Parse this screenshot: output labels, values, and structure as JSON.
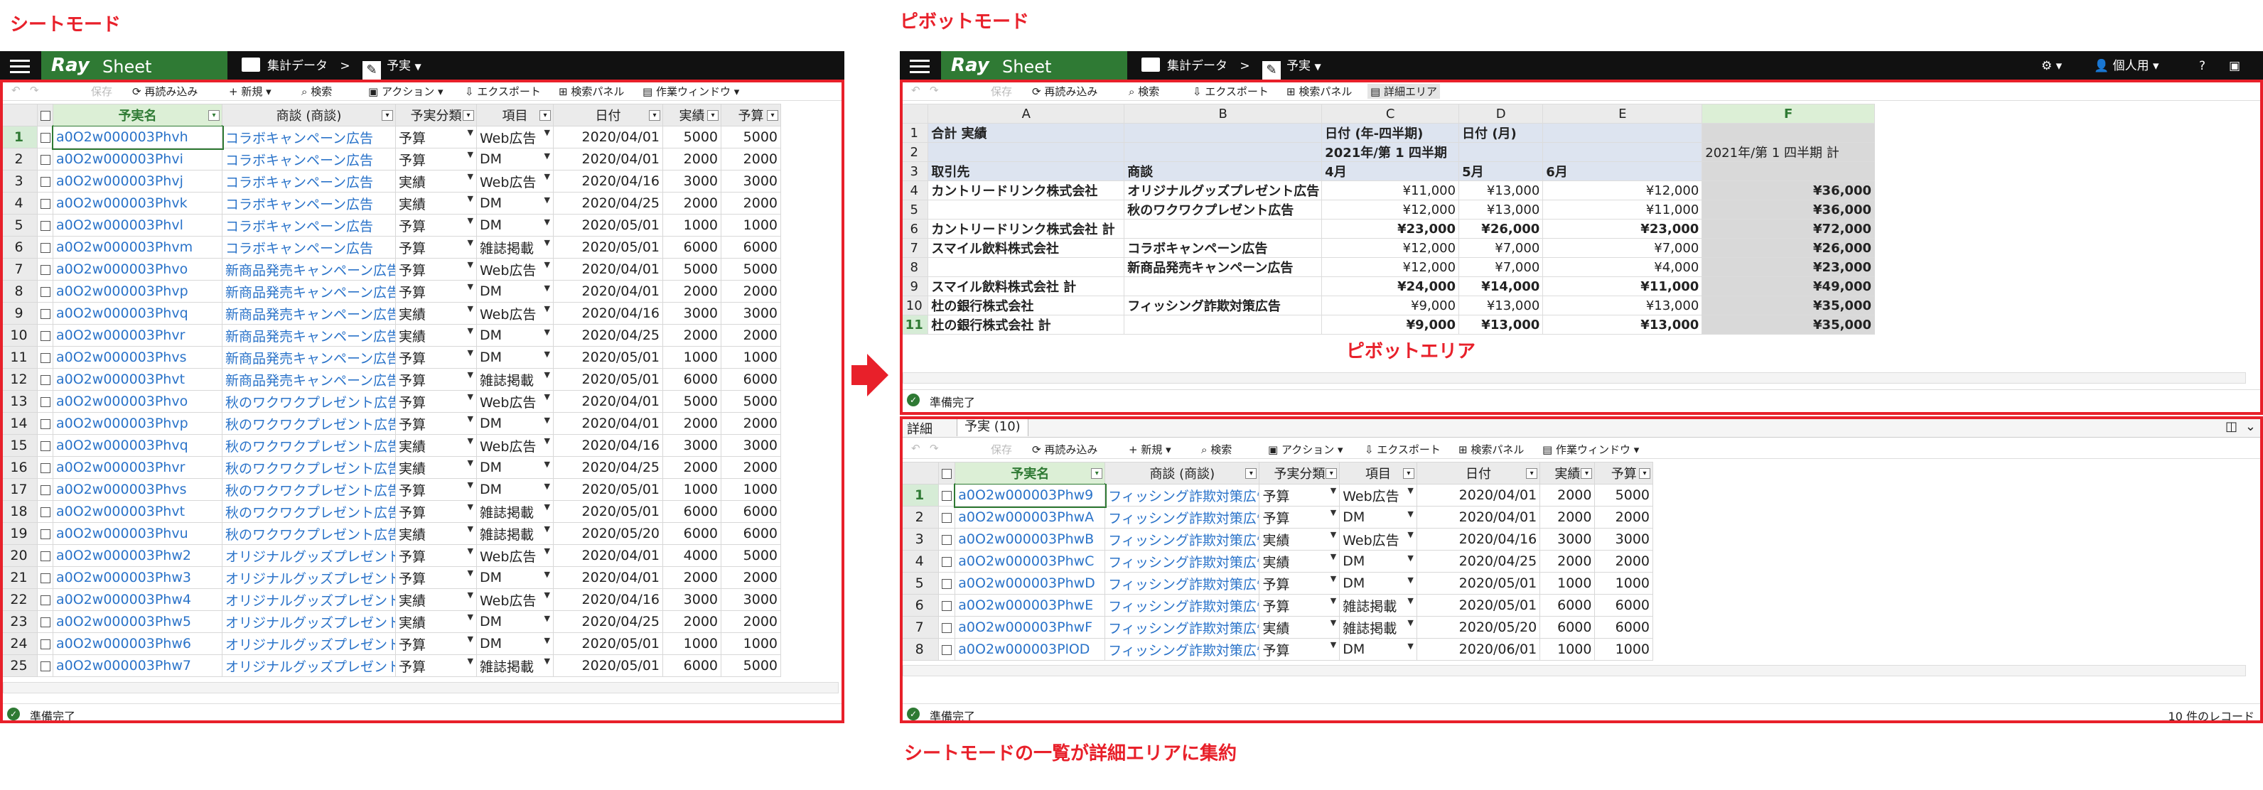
{
  "captions": {
    "sheet_mode": "シートモード",
    "pivot_mode": "ピボットモード",
    "pivot_area": "ピボットエリア",
    "detail_note": "シートモードの一覧が詳細エリアに集約"
  },
  "app": {
    "brand_main": "Ray",
    "brand_sub": "Sheet",
    "crumb_folder": "集計データ",
    "crumb_sep": ">",
    "crumb_sheet": "予実",
    "user_label": "個人用",
    "help": "?"
  },
  "toolbar": {
    "undo": "↶",
    "redo": "↷",
    "save": "保存",
    "reload": "再読み込み",
    "new": "新規",
    "search": "検索",
    "action": "アクション",
    "export": "エクスポート",
    "search_panel": "検索パネル",
    "work_window": "作業ウィンドウ",
    "detail_area": "詳細エリア"
  },
  "sheet": {
    "headers": [
      "予実名",
      "商談 (商談)",
      "予実分類",
      "項目",
      "日付",
      "実績",
      "予算"
    ],
    "rows": [
      [
        "a0O2w000003Phvh",
        "コラボキャンペーン広告",
        "予算",
        "Web広告",
        "2020/04/01",
        "5000",
        "5000"
      ],
      [
        "a0O2w000003Phvi",
        "コラボキャンペーン広告",
        "予算",
        "DM",
        "2020/04/01",
        "2000",
        "2000"
      ],
      [
        "a0O2w000003Phvj",
        "コラボキャンペーン広告",
        "実績",
        "Web広告",
        "2020/04/16",
        "3000",
        "3000"
      ],
      [
        "a0O2w000003Phvk",
        "コラボキャンペーン広告",
        "実績",
        "DM",
        "2020/04/25",
        "2000",
        "2000"
      ],
      [
        "a0O2w000003Phvl",
        "コラボキャンペーン広告",
        "予算",
        "DM",
        "2020/05/01",
        "1000",
        "1000"
      ],
      [
        "a0O2w000003Phvm",
        "コラボキャンペーン広告",
        "予算",
        "雑誌掲載",
        "2020/05/01",
        "6000",
        "6000"
      ],
      [
        "a0O2w000003Phvo",
        "新商品発売キャンペーン広告",
        "予算",
        "Web広告",
        "2020/04/01",
        "5000",
        "5000"
      ],
      [
        "a0O2w000003Phvp",
        "新商品発売キャンペーン広告",
        "予算",
        "DM",
        "2020/04/01",
        "2000",
        "2000"
      ],
      [
        "a0O2w000003Phvq",
        "新商品発売キャンペーン広告",
        "実績",
        "Web広告",
        "2020/04/16",
        "3000",
        "3000"
      ],
      [
        "a0O2w000003Phvr",
        "新商品発売キャンペーン広告",
        "実績",
        "DM",
        "2020/04/25",
        "2000",
        "2000"
      ],
      [
        "a0O2w000003Phvs",
        "新商品発売キャンペーン広告",
        "予算",
        "DM",
        "2020/05/01",
        "1000",
        "1000"
      ],
      [
        "a0O2w000003Phvt",
        "新商品発売キャンペーン広告",
        "予算",
        "雑誌掲載",
        "2020/05/01",
        "6000",
        "6000"
      ],
      [
        "a0O2w000003Phvo",
        "秋のワクワクプレゼント広告",
        "予算",
        "Web広告",
        "2020/04/01",
        "5000",
        "5000"
      ],
      [
        "a0O2w000003Phvp",
        "秋のワクワクプレゼント広告",
        "予算",
        "DM",
        "2020/04/01",
        "2000",
        "2000"
      ],
      [
        "a0O2w000003Phvq",
        "秋のワクワクプレゼント広告",
        "実績",
        "Web広告",
        "2020/04/16",
        "3000",
        "3000"
      ],
      [
        "a0O2w000003Phvr",
        "秋のワクワクプレゼント広告",
        "実績",
        "DM",
        "2020/04/25",
        "2000",
        "2000"
      ],
      [
        "a0O2w000003Phvs",
        "秋のワクワクプレゼント広告",
        "予算",
        "DM",
        "2020/05/01",
        "1000",
        "1000"
      ],
      [
        "a0O2w000003Phvt",
        "秋のワクワクプレゼント広告",
        "予算",
        "雑誌掲載",
        "2020/05/01",
        "6000",
        "6000"
      ],
      [
        "a0O2w000003Phvu",
        "秋のワクワクプレゼント広告",
        "実績",
        "雑誌掲載",
        "2020/05/20",
        "6000",
        "6000"
      ],
      [
        "a0O2w000003Phw2",
        "オリジナルグッズプレゼント広告",
        "予算",
        "Web広告",
        "2020/04/01",
        "4000",
        "5000"
      ],
      [
        "a0O2w000003Phw3",
        "オリジナルグッズプレゼント広告",
        "予算",
        "DM",
        "2020/04/01",
        "2000",
        "2000"
      ],
      [
        "a0O2w000003Phw4",
        "オリジナルグッズプレゼント広告",
        "実績",
        "Web広告",
        "2020/04/16",
        "3000",
        "3000"
      ],
      [
        "a0O2w000003Phw5",
        "オリジナルグッズプレゼント広告",
        "実績",
        "DM",
        "2020/04/25",
        "2000",
        "2000"
      ],
      [
        "a0O2w000003Phw6",
        "オリジナルグッズプレゼント広告",
        "予算",
        "DM",
        "2020/05/01",
        "1000",
        "1000"
      ],
      [
        "a0O2w000003Phw7",
        "オリジナルグッズプレゼント広告",
        "予算",
        "雑誌掲載",
        "2020/05/01",
        "6000",
        "5000"
      ]
    ],
    "status": "準備完了"
  },
  "pivot": {
    "col_letters": [
      "A",
      "B",
      "C",
      "D",
      "E",
      "F"
    ],
    "r1": {
      "a": "合計 実績",
      "c": "日付 (年-四半期)",
      "d": "日付 (月)"
    },
    "r2": {
      "c": "2021年/第 1 四半期",
      "f": "2021年/第 1 四半期 計"
    },
    "r3": {
      "a": "取引先",
      "b": "商談",
      "c": "4月",
      "d": "5月",
      "e": "6月"
    },
    "rows": [
      [
        "4",
        "カントリードリンク株式会社",
        "オリジナルグッズプレゼント広告",
        "¥11,000",
        "¥13,000",
        "¥12,000",
        "¥36,000"
      ],
      [
        "5",
        "",
        "秋のワクワクプレゼント広告",
        "¥12,000",
        "¥13,000",
        "¥11,000",
        "¥36,000"
      ],
      [
        "6",
        "カントリードリンク株式会社 計",
        "",
        "¥23,000",
        "¥26,000",
        "¥23,000",
        "¥72,000"
      ],
      [
        "7",
        "スマイル飲料株式会社",
        "コラボキャンペーン広告",
        "¥12,000",
        "¥7,000",
        "¥7,000",
        "¥26,000"
      ],
      [
        "8",
        "",
        "新商品発売キャンペーン広告",
        "¥12,000",
        "¥7,000",
        "¥4,000",
        "¥23,000"
      ],
      [
        "9",
        "スマイル飲料株式会社 計",
        "",
        "¥24,000",
        "¥14,000",
        "¥11,000",
        "¥49,000"
      ],
      [
        "10",
        "杜の銀行株式会社",
        "フィッシング詐欺対策広告",
        "¥9,000",
        "¥13,000",
        "¥13,000",
        "¥35,000"
      ],
      [
        "11",
        "杜の銀行株式会社 計",
        "",
        "¥9,000",
        "¥13,000",
        "¥13,000",
        "¥35,000"
      ]
    ],
    "status": "準備完了"
  },
  "detail": {
    "label": "詳細",
    "tab": "予実 (10)",
    "headers": [
      "予実名",
      "商談 (商談)",
      "予実分類",
      "項目",
      "日付",
      "実績",
      "予算"
    ],
    "rows": [
      [
        "a0O2w000003Phw9",
        "フィッシング詐欺対策広告",
        "予算",
        "Web広告",
        "2020/04/01",
        "2000",
        "5000"
      ],
      [
        "a0O2w000003PhwA",
        "フィッシング詐欺対策広告",
        "予算",
        "DM",
        "2020/04/01",
        "2000",
        "2000"
      ],
      [
        "a0O2w000003PhwB",
        "フィッシング詐欺対策広告",
        "実績",
        "Web広告",
        "2020/04/16",
        "3000",
        "3000"
      ],
      [
        "a0O2w000003PhwC",
        "フィッシング詐欺対策広告",
        "実績",
        "DM",
        "2020/04/25",
        "2000",
        "2000"
      ],
      [
        "a0O2w000003PhwD",
        "フィッシング詐欺対策広告",
        "予算",
        "DM",
        "2020/05/01",
        "1000",
        "1000"
      ],
      [
        "a0O2w000003PhwE",
        "フィッシング詐欺対策広告",
        "予算",
        "雑誌掲載",
        "2020/05/01",
        "6000",
        "6000"
      ],
      [
        "a0O2w000003PhwF",
        "フィッシング詐欺対策広告",
        "実績",
        "雑誌掲載",
        "2020/05/20",
        "6000",
        "6000"
      ],
      [
        "a0O2w000003PlOD",
        "フィッシング詐欺対策広告",
        "予算",
        "DM",
        "2020/06/01",
        "1000",
        "1000"
      ]
    ],
    "status": "準備完了",
    "record_count": "10 件のレコード"
  }
}
